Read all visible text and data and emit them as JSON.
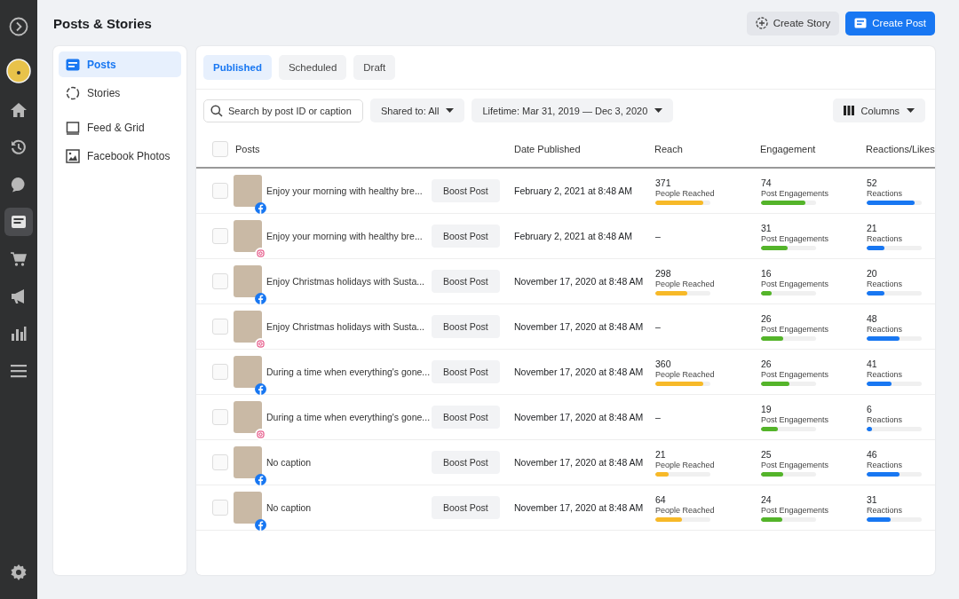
{
  "rail": [
    {
      "kind": "brand",
      "selected": false
    },
    {
      "kind": "avatar",
      "selected": false
    },
    {
      "kind": "home",
      "selected": false
    },
    {
      "kind": "history",
      "selected": false
    },
    {
      "kind": "chat",
      "selected": false
    },
    {
      "kind": "posts",
      "selected": true
    },
    {
      "kind": "cart",
      "selected": false
    },
    {
      "kind": "megaphone",
      "selected": false
    },
    {
      "kind": "chart",
      "selected": false
    },
    {
      "kind": "menu",
      "selected": false
    }
  ],
  "rail_bottom": {
    "kind": "settings"
  },
  "page_title": "Posts & Stories",
  "header_buttons": [
    {
      "label": "Create Story",
      "kind": "secondary"
    },
    {
      "label": "Create Post",
      "kind": "primary"
    }
  ],
  "sidebar": {
    "items": [
      {
        "label": "Posts",
        "kind": "posts",
        "selected": true
      },
      {
        "label": "Stories",
        "kind": "stories",
        "selected": false
      },
      {
        "label": "Feed & Grid",
        "kind": "grid",
        "selected": false
      },
      {
        "label": "Facebook Photos",
        "kind": "photos",
        "selected": false
      }
    ]
  },
  "tabs": [
    {
      "label": "Published",
      "selected": true
    },
    {
      "label": "Scheduled",
      "selected": false
    },
    {
      "label": "Draft",
      "selected": false
    }
  ],
  "search": {
    "placeholder": "Search by post ID or caption"
  },
  "filters": [
    {
      "label": "Shared to: All"
    },
    {
      "label": "Lifetime: Mar 31, 2019 — Dec 3, 2020"
    }
  ],
  "columns_button": {
    "label": "Columns"
  },
  "table": {
    "columns": [
      "Posts",
      "Date Published",
      "Reach",
      "Engagement",
      "Reactions/Likes"
    ],
    "header_checked": false,
    "rows": [
      {
        "checked": false,
        "kind": "facebook",
        "caption": "Enjoy your morning with healthy bre...",
        "button": "Boost Post",
        "date": "February 2, 2021 at 8:48 AM",
        "reach": {
          "value": "371",
          "label": "People Reached",
          "level": 0.87
        },
        "engagement": {
          "value": "74",
          "label": "Post Engagements",
          "level": 0.8
        },
        "reactions": {
          "value": "52",
          "label": "Reactions",
          "level": 0.87
        }
      },
      {
        "checked": false,
        "kind": "instagram",
        "caption": "Enjoy your morning with healthy bre...",
        "button": "Boost Post",
        "date": "February 2, 2021 at 8:48 AM",
        "reach": {
          "value": "–"
        },
        "engagement": {
          "value": "31",
          "label": "Post Engagements",
          "level": 0.48
        },
        "reactions": {
          "value": "21",
          "label": "Reactions",
          "level": 0.33
        }
      },
      {
        "checked": false,
        "kind": "facebook",
        "caption": "Enjoy Christmas holidays with Susta...",
        "button": "Boost Post",
        "date": "November 17, 2020 at 8:48 AM",
        "reach": {
          "value": "298",
          "label": "People Reached",
          "level": 0.58
        },
        "engagement": {
          "value": "16",
          "label": "Post Engagements",
          "level": 0.2
        },
        "reactions": {
          "value": "20",
          "label": "Reactions",
          "level": 0.33
        }
      },
      {
        "checked": false,
        "kind": "instagram",
        "caption": "Enjoy Christmas holidays with Susta...",
        "button": "Boost Post",
        "date": "November 17, 2020 at 8:48 AM",
        "reach": {
          "value": "–"
        },
        "engagement": {
          "value": "26",
          "label": "Post Engagements",
          "level": 0.4
        },
        "reactions": {
          "value": "48",
          "label": "Reactions",
          "level": 0.6
        }
      },
      {
        "checked": false,
        "kind": "facebook",
        "caption": "During a time when everything's gone...",
        "button": "Boost Post",
        "date": "November 17, 2020 at 8:48 AM",
        "reach": {
          "value": "360",
          "label": "People Reached",
          "level": 0.87
        },
        "engagement": {
          "value": "26",
          "label": "Post Engagements",
          "level": 0.52
        },
        "reactions": {
          "value": "41",
          "label": "Reactions",
          "level": 0.45
        }
      },
      {
        "checked": false,
        "kind": "instagram",
        "caption": "During a time when everything's gone...",
        "button": "Boost Post",
        "date": "November 17, 2020 at 8:48 AM",
        "reach": {
          "value": "–"
        },
        "engagement": {
          "value": "19",
          "label": "Post Engagements",
          "level": 0.3
        },
        "reactions": {
          "value": "6",
          "label": "Reactions",
          "level": 0.1
        }
      },
      {
        "checked": false,
        "kind": "facebook",
        "caption": "No caption",
        "button": "Boost Post",
        "date": "November 17, 2020 at 8:48 AM",
        "reach": {
          "value": "21",
          "label": "People Reached",
          "level": 0.24
        },
        "engagement": {
          "value": "25",
          "label": "Post Engagements",
          "level": 0.4
        },
        "reactions": {
          "value": "46",
          "label": "Reactions",
          "level": 0.6
        }
      },
      {
        "checked": false,
        "kind": "facebook",
        "caption": "No caption",
        "button": "Boost Post",
        "date": "November 17, 2020 at 8:48 AM",
        "reach": {
          "value": "64",
          "label": "People Reached",
          "level": 0.48
        },
        "engagement": {
          "value": "24",
          "label": "Post Engagements",
          "level": 0.38
        },
        "reactions": {
          "value": "31",
          "label": "Reactions",
          "level": 0.43
        }
      }
    ]
  }
}
